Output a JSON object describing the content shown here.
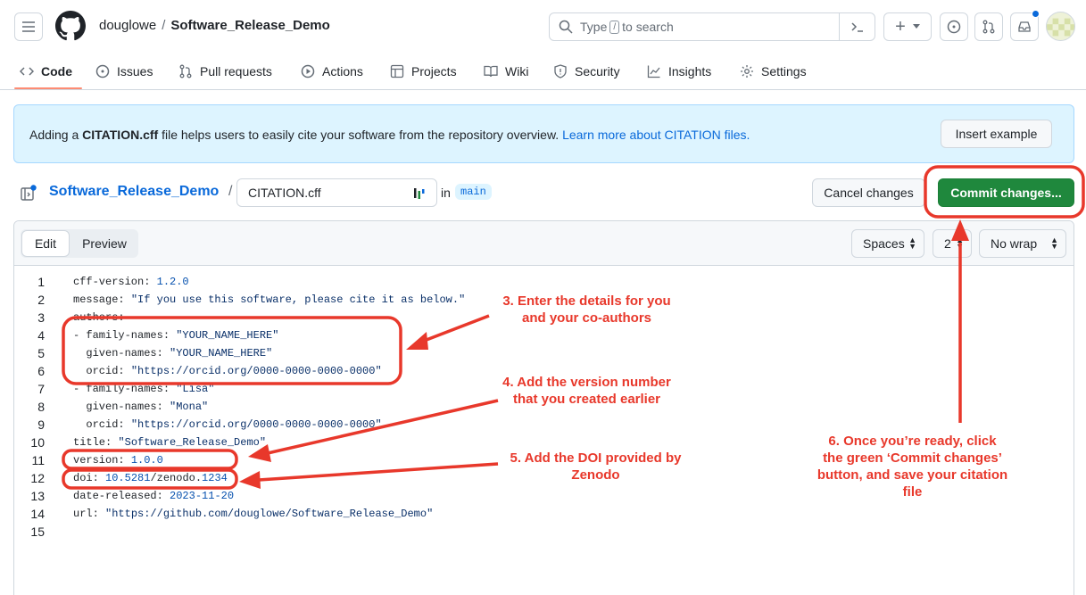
{
  "header": {
    "owner": "douglowe",
    "separator": "/",
    "repo": "Software_Release_Demo",
    "search_prefix": "Type",
    "search_key": "/",
    "search_suffix": "to search",
    "plus": "+"
  },
  "tabs": [
    {
      "label": "Code",
      "icon": "code-icon",
      "active": true
    },
    {
      "label": "Issues",
      "icon": "issue-icon"
    },
    {
      "label": "Pull requests",
      "icon": "pull-request-icon"
    },
    {
      "label": "Actions",
      "icon": "play-icon"
    },
    {
      "label": "Projects",
      "icon": "table-icon"
    },
    {
      "label": "Wiki",
      "icon": "book-icon"
    },
    {
      "label": "Security",
      "icon": "shield-icon"
    },
    {
      "label": "Insights",
      "icon": "graph-icon"
    },
    {
      "label": "Settings",
      "icon": "gear-icon"
    }
  ],
  "banner": {
    "prefix": "Adding a ",
    "file": "CITATION.cff",
    "suffix": " file helps users to easily cite your software from the repository overview.",
    "link": "Learn more about CITATION files.",
    "insert_button": "Insert example"
  },
  "path": {
    "repo": "Software_Release_Demo",
    "slash": "/",
    "filename": "CITATION.cff",
    "in_label": "in",
    "branch": "main",
    "cancel_button": "Cancel changes",
    "commit_button": "Commit changes..."
  },
  "editor": {
    "edit_tab": "Edit",
    "preview_tab": "Preview",
    "indent_mode": "Spaces",
    "indent_size": "2",
    "wrap_mode": "No wrap"
  },
  "code_lines": [
    {
      "n": "1",
      "parts": [
        [
          "k",
          "cff-version: "
        ],
        [
          "num",
          "1.2.0"
        ]
      ]
    },
    {
      "n": "2",
      "parts": [
        [
          "k",
          "message: "
        ],
        [
          "str",
          "\"If you use this software, please cite it as below.\""
        ]
      ]
    },
    {
      "n": "3",
      "parts": [
        [
          "k",
          "authors:"
        ]
      ]
    },
    {
      "n": "4",
      "parts": [
        [
          "k",
          "- family-names: "
        ],
        [
          "str",
          "\"YOUR_NAME_HERE\""
        ]
      ]
    },
    {
      "n": "5",
      "parts": [
        [
          "k",
          "  given-names: "
        ],
        [
          "str",
          "\"YOUR_NAME_HERE\""
        ]
      ]
    },
    {
      "n": "6",
      "parts": [
        [
          "k",
          "  orcid: "
        ],
        [
          "str",
          "\"https://orcid.org/0000-0000-0000-0000\""
        ]
      ]
    },
    {
      "n": "7",
      "parts": [
        [
          "k",
          "- family-names: "
        ],
        [
          "str",
          "\"Lisa\""
        ]
      ]
    },
    {
      "n": "8",
      "parts": [
        [
          "k",
          "  given-names: "
        ],
        [
          "str",
          "\"Mona\""
        ]
      ]
    },
    {
      "n": "9",
      "parts": [
        [
          "k",
          "  orcid: "
        ],
        [
          "str",
          "\"https://orcid.org/0000-0000-0000-0000\""
        ]
      ]
    },
    {
      "n": "10",
      "parts": [
        [
          "k",
          "title: "
        ],
        [
          "str",
          "\"Software_Release_Demo\""
        ]
      ]
    },
    {
      "n": "11",
      "parts": [
        [
          "k",
          "version: "
        ],
        [
          "num",
          "1.0.0"
        ]
      ]
    },
    {
      "n": "12",
      "parts": [
        [
          "k",
          "doi: "
        ],
        [
          "num",
          "10.5281"
        ],
        [
          "k",
          "/zenodo."
        ],
        [
          "num",
          "1234"
        ]
      ]
    },
    {
      "n": "13",
      "parts": [
        [
          "k",
          "date-released: "
        ],
        [
          "num",
          "2023-11-20"
        ]
      ]
    },
    {
      "n": "14",
      "parts": [
        [
          "k",
          "url: "
        ],
        [
          "str",
          "\"https://github.com/douglowe/Software_Release_Demo\""
        ]
      ]
    },
    {
      "n": "15",
      "parts": []
    }
  ],
  "annotations": {
    "step3": [
      "3. Enter the details for you",
      "and your co-authors"
    ],
    "step4": [
      "4. Add the version number",
      "that you created earlier"
    ],
    "step5": [
      "5. Add the DOI provided by",
      "Zenodo"
    ],
    "step6": [
      "6. Once you’re ready, click",
      "the green ‘Commit changes’",
      "button, and save your citation",
      "file"
    ],
    "color": "#e8382b"
  },
  "colors": {
    "commit_green": "#1f883d",
    "link_blue": "#0969da",
    "banner_bg": "#ddf4ff",
    "tab_underline": "#fd8c73"
  }
}
